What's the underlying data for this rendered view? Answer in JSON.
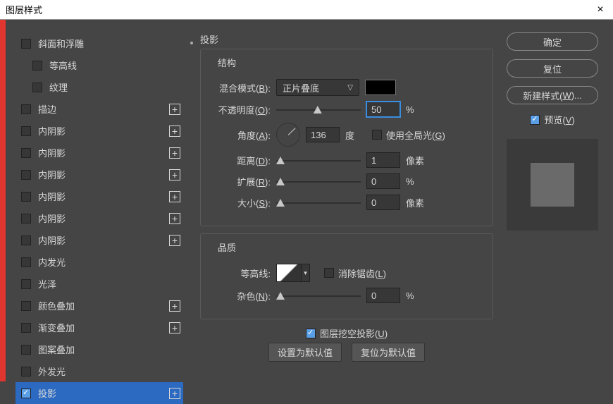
{
  "window": {
    "title": "图层样式"
  },
  "sidebar": {
    "items": [
      {
        "label": "斜面和浮雕",
        "checked": false,
        "plus": false,
        "indent": false
      },
      {
        "label": "等高线",
        "checked": false,
        "plus": false,
        "indent": true
      },
      {
        "label": "纹理",
        "checked": false,
        "plus": false,
        "indent": true
      },
      {
        "label": "描边",
        "checked": false,
        "plus": true,
        "indent": false
      },
      {
        "label": "内阴影",
        "checked": false,
        "plus": true,
        "indent": false
      },
      {
        "label": "内阴影",
        "checked": false,
        "plus": true,
        "indent": false
      },
      {
        "label": "内阴影",
        "checked": false,
        "plus": true,
        "indent": false
      },
      {
        "label": "内阴影",
        "checked": false,
        "plus": true,
        "indent": false
      },
      {
        "label": "内阴影",
        "checked": false,
        "plus": true,
        "indent": false
      },
      {
        "label": "内阴影",
        "checked": false,
        "plus": true,
        "indent": false
      },
      {
        "label": "内发光",
        "checked": false,
        "plus": false,
        "indent": false
      },
      {
        "label": "光泽",
        "checked": false,
        "plus": false,
        "indent": false
      },
      {
        "label": "颜色叠加",
        "checked": false,
        "plus": true,
        "indent": false
      },
      {
        "label": "渐变叠加",
        "checked": false,
        "plus": true,
        "indent": false
      },
      {
        "label": "图案叠加",
        "checked": false,
        "plus": false,
        "indent": false
      },
      {
        "label": "外发光",
        "checked": false,
        "plus": false,
        "indent": false
      },
      {
        "label": "投影",
        "checked": true,
        "plus": true,
        "indent": false,
        "selected": true
      }
    ]
  },
  "main": {
    "title": "投影",
    "struct": {
      "legend": "结构",
      "blend": {
        "label": "混合模式(",
        "hot": "B",
        "tail": "):",
        "value": "正片叠底"
      },
      "opacity": {
        "label": "不透明度(",
        "hot": "O",
        "tail": "):",
        "value": "50",
        "unit": "%",
        "thumb": 44
      },
      "angle": {
        "label": "角度(",
        "hot": "A",
        "tail": "):",
        "value": "136",
        "unit": "度",
        "global": {
          "label": "使用全局光(",
          "hot": "G",
          "tail": ")"
        }
      },
      "distance": {
        "label": "距离(",
        "hot": "D",
        "tail": "):",
        "value": "1",
        "unit": "像素",
        "thumb": 0
      },
      "spread": {
        "label": "扩展(",
        "hot": "R",
        "tail": "):",
        "value": "0",
        "unit": "%",
        "thumb": 0
      },
      "size": {
        "label": "大小(",
        "hot": "S",
        "tail": "):",
        "value": "0",
        "unit": "像素",
        "thumb": 0
      }
    },
    "quality": {
      "legend": "品质",
      "contour": {
        "label": "等高线:"
      },
      "anti": {
        "label": "消除锯齿(",
        "hot": "L",
        "tail": ")"
      },
      "noise": {
        "label": "杂色(",
        "hot": "N",
        "tail": "):",
        "value": "0",
        "unit": "%",
        "thumb": 0
      }
    },
    "knockout": {
      "label": "图层挖空投影(",
      "hot": "U",
      "tail": ")",
      "checked": true
    },
    "defaults": {
      "set": "设置为默认值",
      "reset": "复位为默认值"
    }
  },
  "right": {
    "ok": "确定",
    "reset": "复位",
    "newstyle": {
      "label": "新建样式(",
      "hot": "W",
      "tail": ")..."
    },
    "preview": {
      "label": "预览(",
      "hot": "V",
      "tail": ")",
      "checked": true
    }
  }
}
